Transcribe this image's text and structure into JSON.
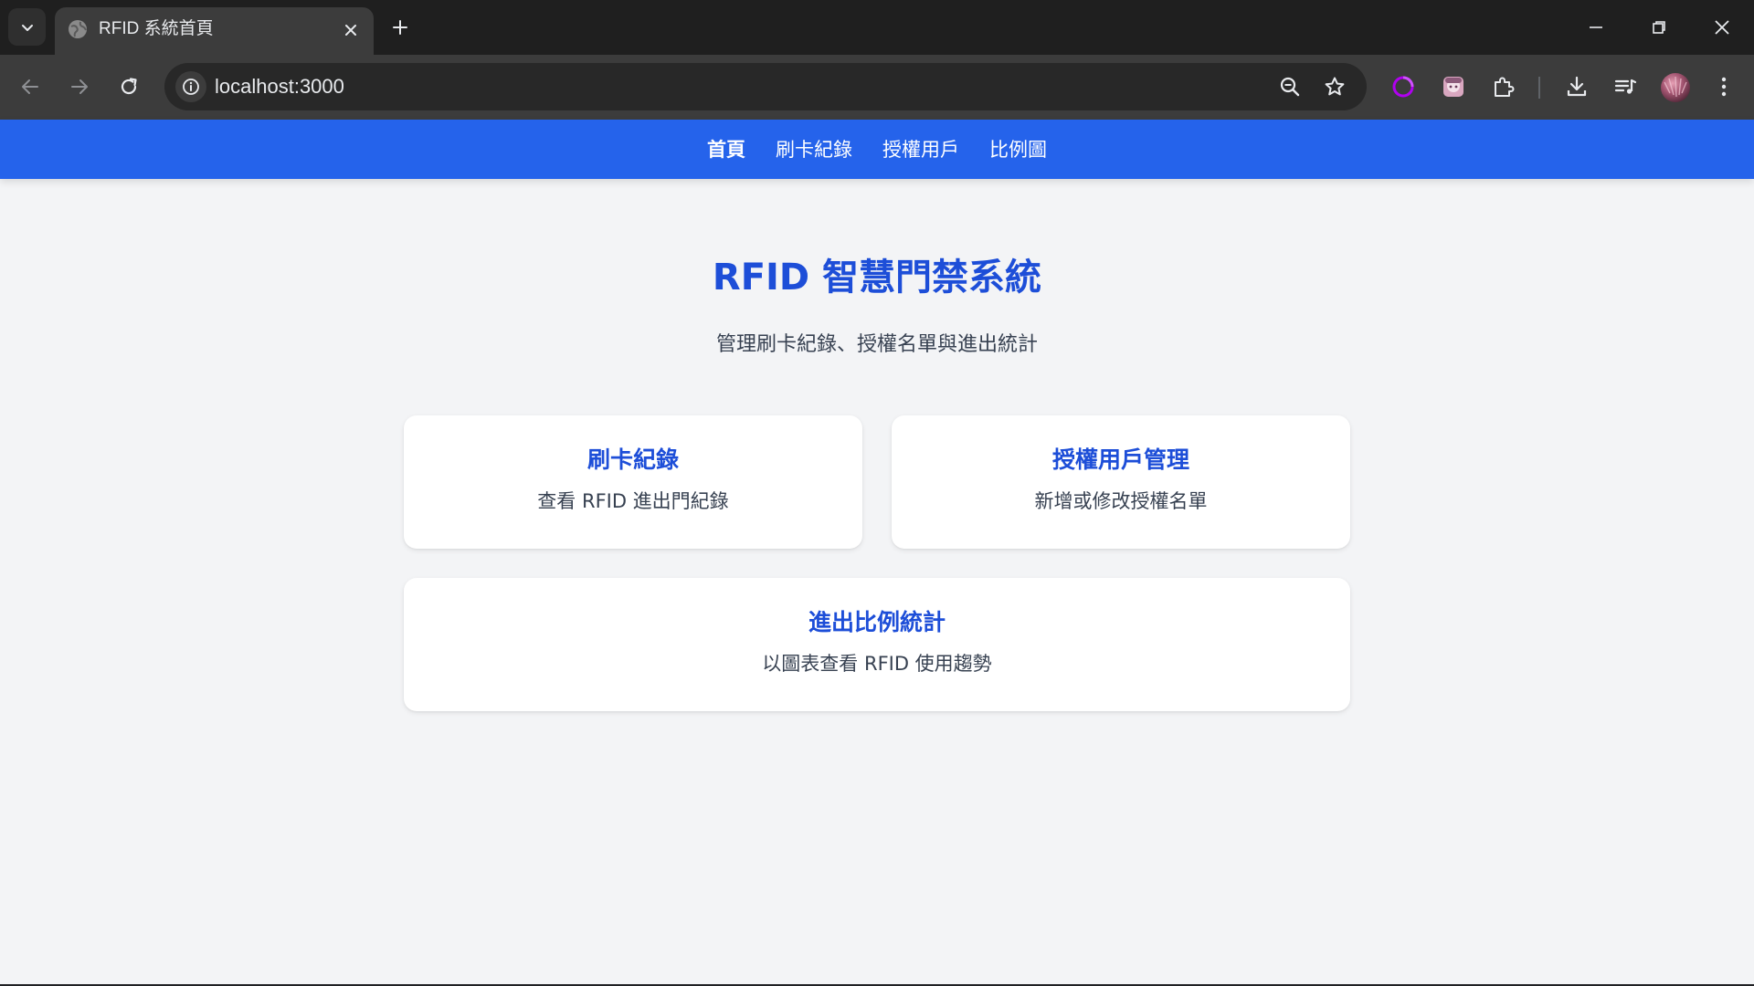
{
  "browser": {
    "tab_title": "RFID 系統首頁",
    "url": "localhost:3000",
    "icons": {
      "tab_search": "chevron-down-icon",
      "favicon": "globe-icon",
      "tab_close": "close-icon",
      "new_tab": "plus-icon",
      "minimize": "minimize-icon",
      "restore": "restore-icon",
      "close_window": "close-icon",
      "back": "arrow-left-icon",
      "forward": "arrow-right-icon",
      "reload": "reload-icon",
      "site_info": "info-icon",
      "zoom": "zoom-out-icon",
      "bookmark": "star-icon",
      "extension_1": "purple-ring-icon",
      "extension_2": "anime-avatar-icon",
      "extensions": "puzzle-icon",
      "downloads": "download-icon",
      "media": "media-queue-icon",
      "profile": "avatar-icon",
      "menu": "kebab-menu-icon"
    }
  },
  "nav": {
    "items": [
      {
        "label": "首頁",
        "active": true
      },
      {
        "label": "刷卡紀錄",
        "active": false
      },
      {
        "label": "授權用戶",
        "active": false
      },
      {
        "label": "比例圖",
        "active": false
      }
    ]
  },
  "hero": {
    "title": "RFID 智慧門禁系統",
    "subtitle": "管理刷卡紀錄、授權名單與進出統計"
  },
  "cards": [
    {
      "title": "刷卡紀錄",
      "description": "查看 RFID 進出門紀錄"
    },
    {
      "title": "授權用戶管理",
      "description": "新增或修改授權名單"
    },
    {
      "title": "進出比例統計",
      "description": "以圖表查看 RFID 使用趨勢"
    }
  ],
  "colors": {
    "nav_bg": "#2563eb",
    "title_blue": "#1d4ed8",
    "page_bg": "#f3f4f6",
    "card_bg": "#ffffff",
    "chrome_dark": "#1f1f1f",
    "chrome_toolbar": "#3c3c3c"
  }
}
